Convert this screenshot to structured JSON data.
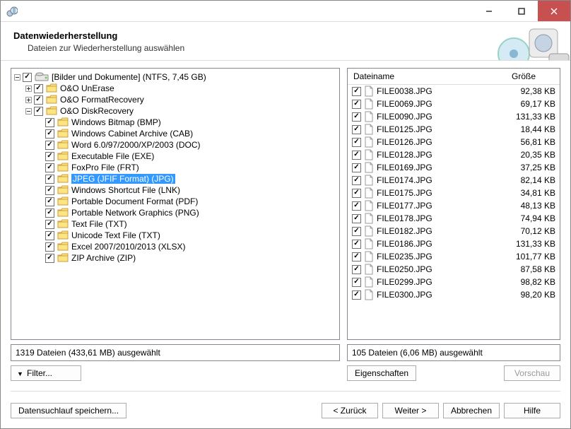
{
  "titlebar": {
    "title": ""
  },
  "header": {
    "title": "Datenwiederherstellung",
    "subtitle": "Dateien zur Wiederherstellung auswählen"
  },
  "tree": {
    "root": {
      "label": "[Bilder und Dokumente] (NTFS, 7,45 GB)",
      "children": [
        {
          "label": "O&O UnErase",
          "expandable": true,
          "expanded": false
        },
        {
          "label": "O&O FormatRecovery",
          "expandable": true,
          "expanded": false
        },
        {
          "label": "O&O DiskRecovery",
          "expandable": true,
          "expanded": true,
          "children": [
            {
              "label": "Windows Bitmap (BMP)"
            },
            {
              "label": "Windows Cabinet Archive (CAB)"
            },
            {
              "label": "Word 6.0/97/2000/XP/2003 (DOC)"
            },
            {
              "label": "Executable File (EXE)"
            },
            {
              "label": "FoxPro File (FRT)"
            },
            {
              "label": "JPEG (JFIF Format) (JPG)",
              "selected": true
            },
            {
              "label": "Windows Shortcut File (LNK)"
            },
            {
              "label": "Portable Document Format (PDF)"
            },
            {
              "label": "Portable Network Graphics (PNG)"
            },
            {
              "label": "Text File (TXT)"
            },
            {
              "label": "Unicode Text File (TXT)"
            },
            {
              "label": "Excel 2007/2010/2013 (XLSX)"
            },
            {
              "label": "ZIP Archive (ZIP)"
            }
          ]
        }
      ]
    }
  },
  "left_status": "1319 Dateien (433,61 MB) ausgewählt",
  "filter_button": "Filter...",
  "file_header": {
    "name": "Dateiname",
    "size": "Größe"
  },
  "files": [
    {
      "name": "FILE0038.JPG",
      "size": "92,38 KB"
    },
    {
      "name": "FILE0069.JPG",
      "size": "69,17 KB"
    },
    {
      "name": "FILE0090.JPG",
      "size": "131,33 KB"
    },
    {
      "name": "FILE0125.JPG",
      "size": "18,44 KB"
    },
    {
      "name": "FILE0126.JPG",
      "size": "56,81 KB"
    },
    {
      "name": "FILE0128.JPG",
      "size": "20,35 KB"
    },
    {
      "name": "FILE0169.JPG",
      "size": "37,25 KB"
    },
    {
      "name": "FILE0174.JPG",
      "size": "82,14 KB"
    },
    {
      "name": "FILE0175.JPG",
      "size": "34,81 KB"
    },
    {
      "name": "FILE0177.JPG",
      "size": "48,13 KB"
    },
    {
      "name": "FILE0178.JPG",
      "size": "74,94 KB"
    },
    {
      "name": "FILE0182.JPG",
      "size": "70,12 KB"
    },
    {
      "name": "FILE0186.JPG",
      "size": "131,33 KB"
    },
    {
      "name": "FILE0235.JPG",
      "size": "101,77 KB"
    },
    {
      "name": "FILE0250.JPG",
      "size": "87,58 KB"
    },
    {
      "name": "FILE0299.JPG",
      "size": "98,82 KB"
    },
    {
      "name": "FILE0300.JPG",
      "size": "98,20 KB"
    }
  ],
  "right_status": "105 Dateien (6,06 MB) ausgewählt",
  "buttons": {
    "properties": "Eigenschaften",
    "preview": "Vorschau",
    "save_scan": "Datensuchlauf speichern...",
    "back": "<  Zurück",
    "next": "Weiter  >",
    "cancel": "Abbrechen",
    "help": "Hilfe"
  }
}
